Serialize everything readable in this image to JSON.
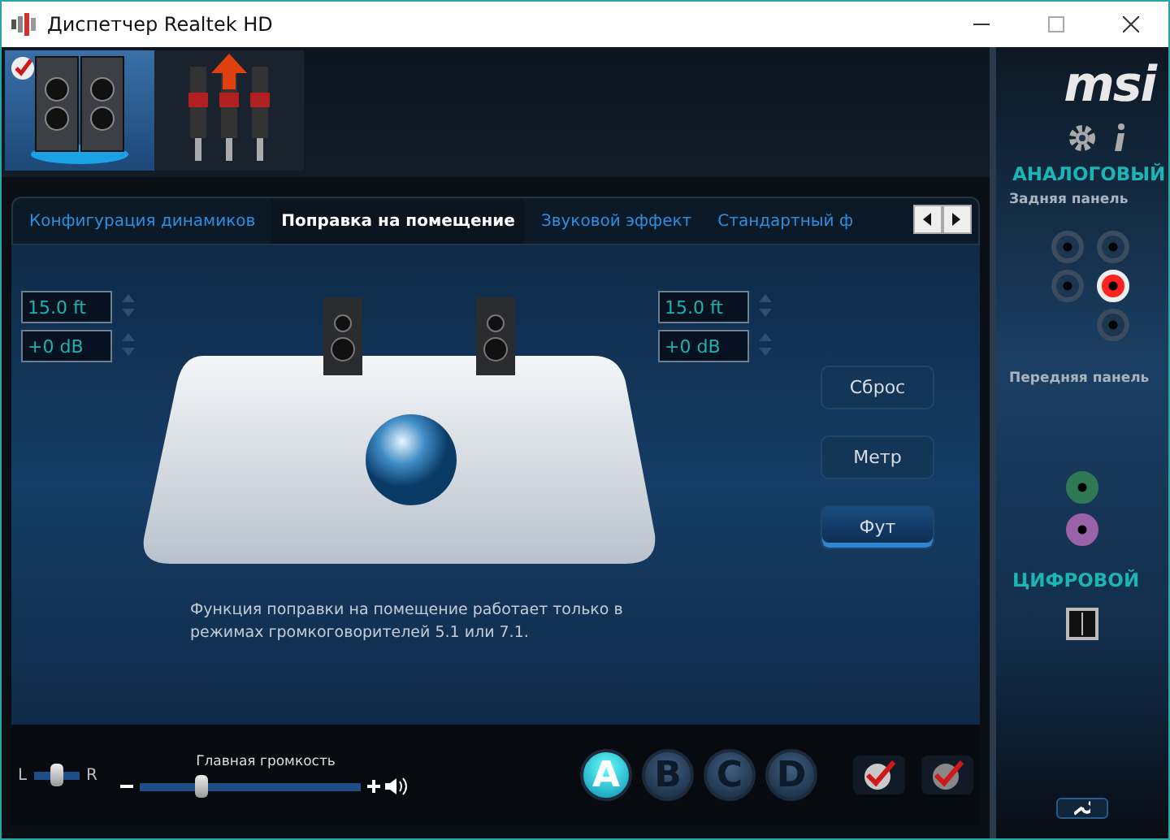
{
  "window": {
    "title": "Диспетчер Realtek HD"
  },
  "devices": [
    {
      "kind": "speakers",
      "selected": true
    },
    {
      "kind": "jacks",
      "selected": false
    }
  ],
  "tabs": [
    {
      "label": "Конфигурация динамиков",
      "selected": false
    },
    {
      "label": "Поправка на помещение",
      "selected": true
    },
    {
      "label": "Звуковой эффект",
      "selected": false
    },
    {
      "label": "Стандартный ф",
      "selected": false
    }
  ],
  "left": {
    "distance": "15.0 ft",
    "gain": "+0 dB"
  },
  "right": {
    "distance": "15.0 ft",
    "gain": "+0 dB"
  },
  "buttons": [
    {
      "label": "Сброс",
      "selected": false
    },
    {
      "label": "Метр",
      "selected": false
    },
    {
      "label": "Фут",
      "selected": true
    }
  ],
  "note": "Функция поправки на помещение работает только в режимах громкоговорителей 5.1 или 7.1.",
  "balance": {
    "left": "L",
    "right": "R",
    "level": 0.5
  },
  "volume": {
    "label": "Главная громкость",
    "level": 0.28
  },
  "profiles": [
    {
      "label": "A",
      "selected": true
    },
    {
      "label": "B",
      "selected": false
    },
    {
      "label": "C",
      "selected": false
    },
    {
      "label": "D",
      "selected": false
    }
  ],
  "side": {
    "logo": "msi",
    "analog": "АНАЛОГОВЫЙ",
    "rear": "Задняя панель",
    "rear_jacks": [
      {
        "plugged": false
      },
      {
        "plugged": false
      },
      {
        "plugged": false
      },
      {
        "plugged": true
      },
      {
        "plugged": false
      }
    ],
    "front": "Передняя панель",
    "front_jacks": [
      {
        "color": "#2f7a55"
      },
      {
        "color": "#9a62a8"
      }
    ],
    "digital": "ЦИФРОВОЙ"
  }
}
